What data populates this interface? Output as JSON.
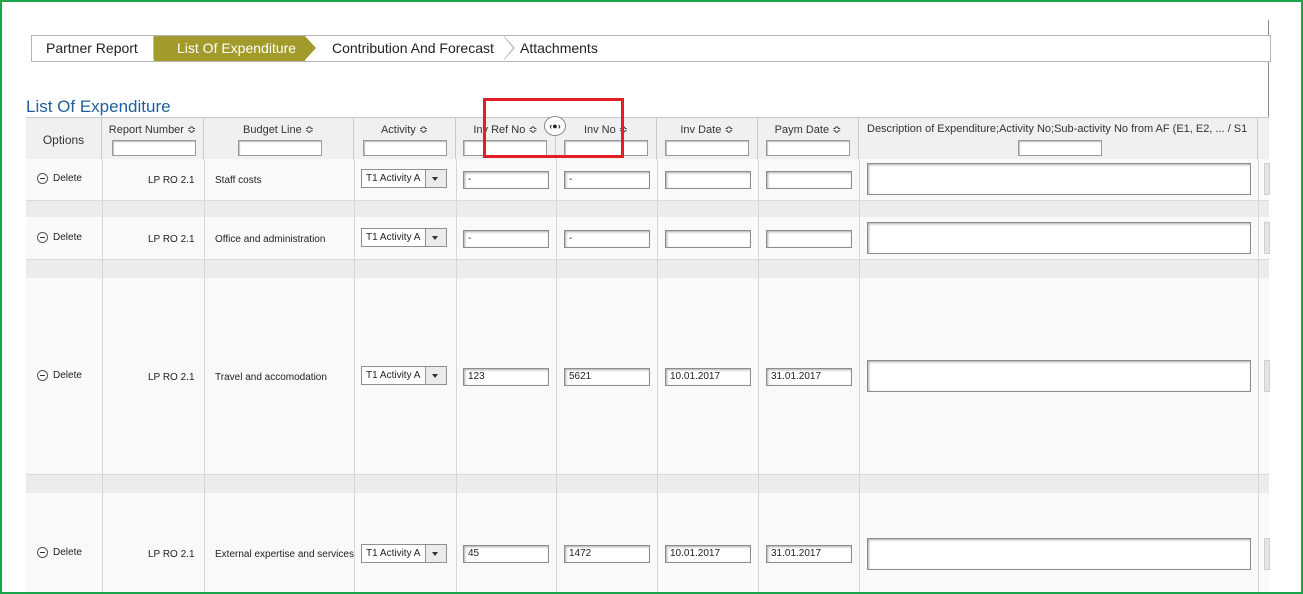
{
  "tabs": [
    "Partner Report",
    "List Of Expenditure",
    "Contribution And Forecast",
    "Attachments"
  ],
  "active_tab": "List Of Expenditure",
  "section_title": "List Of Expenditure",
  "columns": {
    "options": "Options",
    "report_number": "Report Number ≎",
    "budget_line": "Budget Line ≎",
    "activity": "Activity ≎",
    "inv_ref_no": "Inv Ref No ≎",
    "inv_no": "Inv No ≎",
    "inv_date": "Inv Date ≎",
    "paym_date": "Paym Date ≎",
    "description": "Description of Expenditure;Activity No;Sub-activity No from AF (E1, E2, ... / S1"
  },
  "rows": [
    {
      "action": "Delete",
      "report_number": "LP RO 2.1",
      "budget_line": "Staff costs",
      "activity": "T1 Activity A",
      "inv_ref_no": "-",
      "inv_no": "-",
      "inv_date": "",
      "paym_date": ""
    },
    {
      "action": "Delete",
      "report_number": "LP RO 2.1",
      "budget_line": "Office and administration",
      "activity": "T1 Activity A",
      "inv_ref_no": "-",
      "inv_no": "-",
      "inv_date": "",
      "paym_date": ""
    },
    {
      "action": "Delete",
      "report_number": "LP RO 2.1",
      "budget_line": "Travel and accomodation",
      "activity": "T1 Activity A",
      "inv_ref_no": "123",
      "inv_no": "5621",
      "inv_date": "10.01.2017",
      "paym_date": "31.01.2017"
    },
    {
      "action": "Delete",
      "report_number": "LP RO 2.1",
      "budget_line": "External expertise and services",
      "activity": "T1 Activity A",
      "inv_ref_no": "45",
      "inv_no": "1472",
      "inv_date": "10.01.2017",
      "paym_date": "31.01.2017"
    }
  ],
  "resize_handle_glyph": "‹●›",
  "colors": {
    "frame": "#1aa54b",
    "active_tab": "#a39a2c",
    "title": "#1f5f9b",
    "highlight": "#e41e26"
  }
}
